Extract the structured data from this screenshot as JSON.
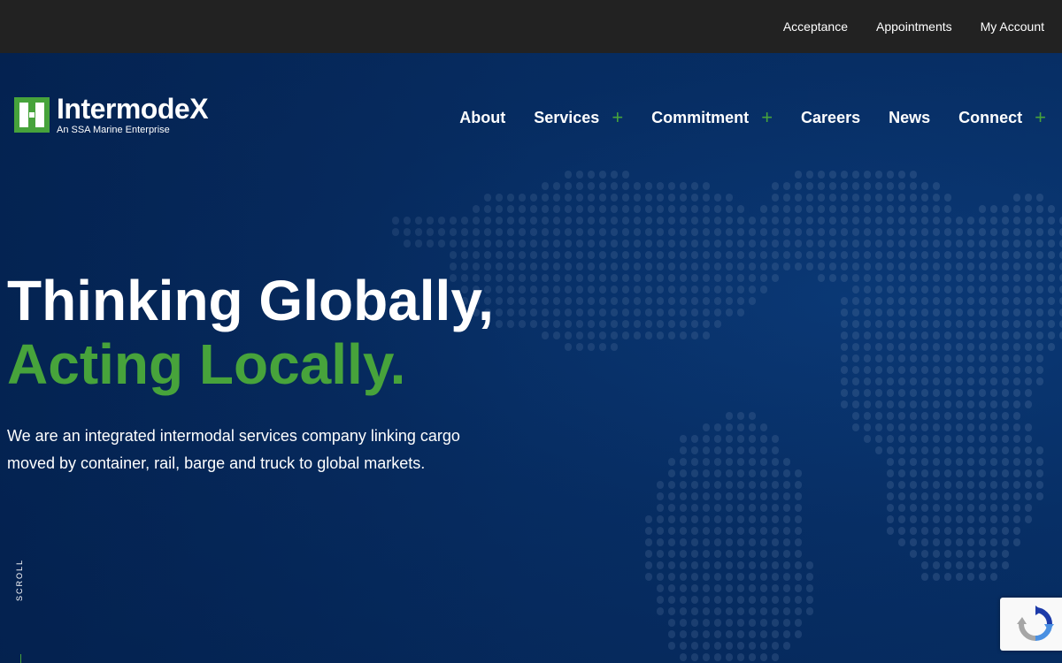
{
  "topbar": {
    "links": [
      "Acceptance",
      "Appointments",
      "My Account"
    ]
  },
  "brand": {
    "name": "IntermodeX",
    "tagline": "An SSA Marine Enterprise"
  },
  "nav": {
    "items": [
      {
        "label": "About",
        "has_submenu": false
      },
      {
        "label": "Services",
        "has_submenu": true
      },
      {
        "label": "Commitment",
        "has_submenu": true
      },
      {
        "label": "Careers",
        "has_submenu": false
      },
      {
        "label": "News",
        "has_submenu": false
      },
      {
        "label": "Connect",
        "has_submenu": true
      }
    ],
    "submenu_glyph": "+"
  },
  "hero": {
    "headline_line1": "Thinking Globally,",
    "headline_line2": "Acting Locally.",
    "intro": "We are an integrated intermodal services company linking cargo moved by container, rail, barge and truck to global markets.",
    "scroll_label": "SCROLL"
  },
  "icons": {
    "logo": "intermodex-logo-icon",
    "recaptcha": "recaptcha-icon",
    "background": "world-map-dots"
  },
  "colors": {
    "accent_green": "#47a33b",
    "hero_blue": "#072f66",
    "topbar": "#222222"
  }
}
